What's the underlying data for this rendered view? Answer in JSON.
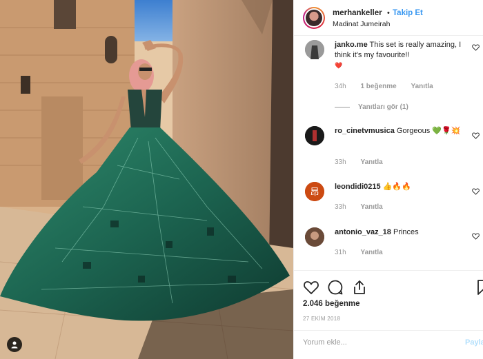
{
  "header": {
    "username": "merhankeller",
    "separator": "•",
    "follow_label": "Takip Et",
    "location": "Madinat Jumeirah"
  },
  "comments": [
    {
      "username": "janko.me",
      "text": "This set is really amazing, I think it's my favourite!!",
      "emoji": "❤️",
      "time": "34h",
      "likes": "1 beğenme",
      "reply": "Yanıtla",
      "view_replies": "Yanıtları gör (1)"
    },
    {
      "username": "ro_cinetvmusica",
      "text": "Gorgeous",
      "emoji": "💚🌹💥",
      "time": "33h",
      "reply": "Yanıtla"
    },
    {
      "username": "leondidi0215",
      "text": "",
      "emoji": "👍🔥🔥",
      "time": "33h",
      "reply": "Yanıtla"
    },
    {
      "username": "antonio_vaz_18",
      "text": "Princes",
      "emoji": "",
      "time": "31h",
      "reply": "Yanıtla"
    }
  ],
  "actions": {
    "like_icon": "heart-icon",
    "comment_icon": "comment-icon",
    "share_icon": "share-icon",
    "save_icon": "bookmark-icon",
    "likes_count": "2.046 beğenme",
    "date": "27 EKİM 2018"
  },
  "comment_box": {
    "placeholder": "Yorum ekle...",
    "post_label": "Paylaş"
  },
  "colors": {
    "link_blue": "#3897f0",
    "muted": "#999999",
    "border": "#efefef",
    "dress_green": "#1f6b55"
  }
}
